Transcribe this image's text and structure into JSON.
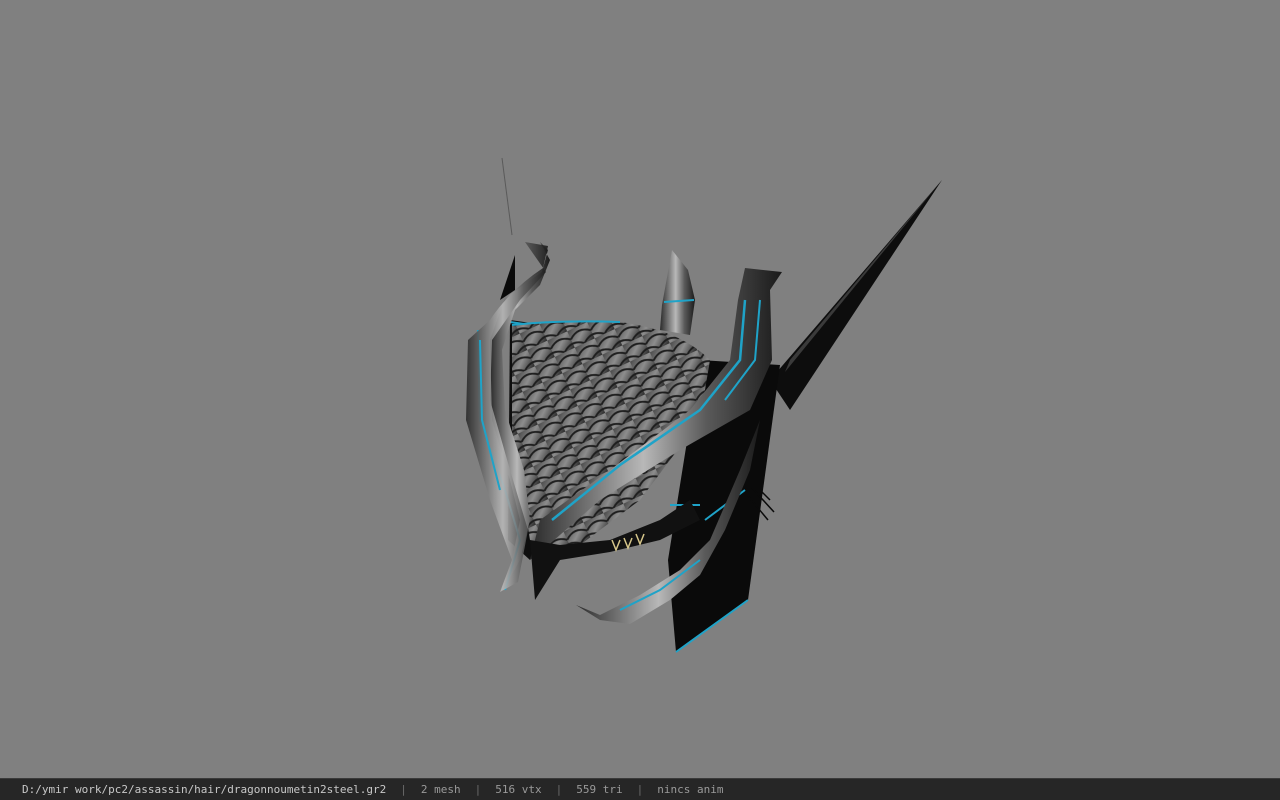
{
  "viewer": {
    "background_color": "#808080",
    "model": {
      "icon": "dragon-helmet-3d-model",
      "accent_color": "#1fa3c8"
    }
  },
  "statusbar": {
    "file_path": "D:/ymir work/pc2/assassin/hair/dragonnoumetin2steel.gr2",
    "separator": "|",
    "mesh_count": "2 mesh",
    "vertex_count": "516 vtx",
    "triangle_count": "559 tri",
    "animation_status": "nincs anim"
  }
}
